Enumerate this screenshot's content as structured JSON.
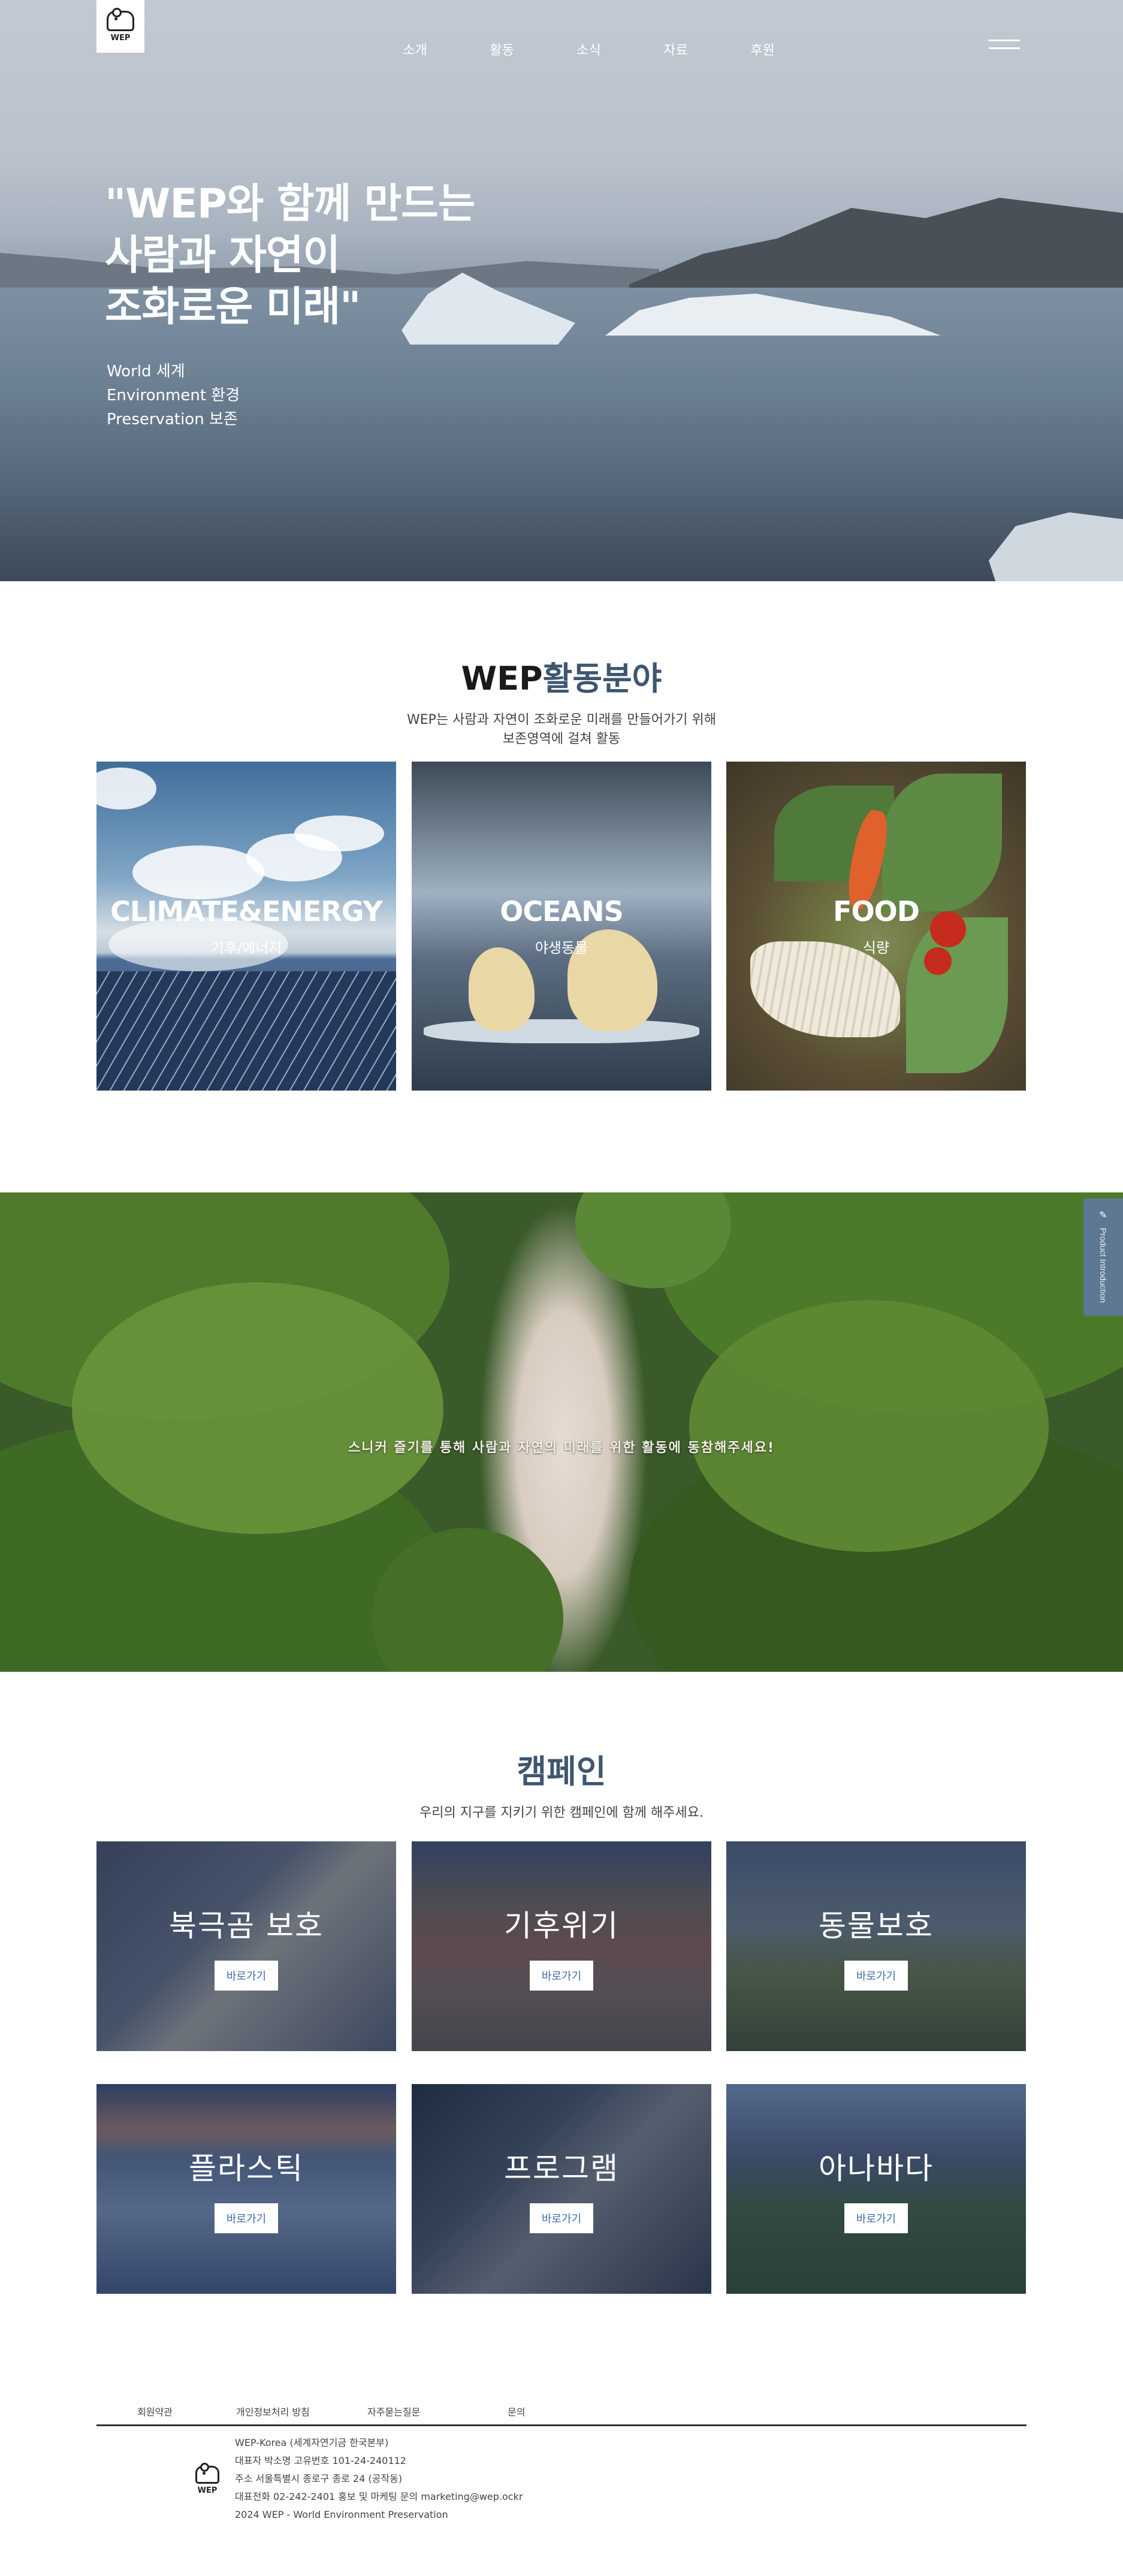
{
  "header": {
    "logo_text": "WEP",
    "nav": [
      "소개",
      "활동",
      "소식",
      "자료",
      "후원"
    ]
  },
  "hero": {
    "title": "\"WEP와 함께 만드는\n사람과 자연이\n조화로운 미래\"",
    "sub": [
      "World 세계",
      "Environment 환경",
      "Preservation 보존"
    ]
  },
  "activity": {
    "title_dark": "WEP",
    "title_blue": "활동분야",
    "desc_line1": "WEP는 사람과 자연이 조화로운 미래를 만들어가기 위해",
    "desc_line2": "보존영역에 걸쳐 활동",
    "cards": [
      {
        "title": "CLIMATE&ENERGY",
        "sub": "기후/에너지"
      },
      {
        "title": "OCEANS",
        "sub": "야생동물"
      },
      {
        "title": "FOOD",
        "sub": "식량"
      }
    ]
  },
  "forest": {
    "text": "스니커 즐기를 통해 사람과 자연의 미래를 위한 활동에 동참해주세요!"
  },
  "side_tab": {
    "label": "Product Introduction"
  },
  "campaign": {
    "title": "캠페인",
    "desc": "우리의 지구를 지키기 위한 캠페인에 함께 해주세요.",
    "button_label": "바로가기",
    "cards": [
      {
        "title": "북극곰 보호"
      },
      {
        "title": "기후위기"
      },
      {
        "title": "동물보호"
      },
      {
        "title": "플라스틱"
      },
      {
        "title": "프로그램"
      },
      {
        "title": "아나바다"
      }
    ]
  },
  "footer": {
    "links": [
      "회원약관",
      "개인정보처리 방침",
      "자주묻는질문",
      "문의"
    ],
    "logo_text": "WEP",
    "info": [
      "WEP-Korea (세계자연기금 한국본부)",
      "대표자 박소명 고유번호 101-24-240112",
      "주소 서울특별시 종로구 종로 24 (공작동)",
      "대표전화 02-242-2401 홍보 및 마케팅 문의 marketing@wep.ockr",
      "2024 WEP - World Environment Preservation"
    ]
  }
}
